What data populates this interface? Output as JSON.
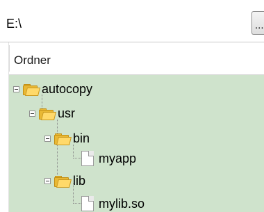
{
  "path": {
    "value": "E:\\",
    "browse_label": "..."
  },
  "tree": {
    "column_header": "Ordner",
    "nodes": [
      {
        "label": "autocopy",
        "type": "folder",
        "icon": "folder-icon",
        "expanded": true,
        "depth": 0
      },
      {
        "label": "usr",
        "type": "folder",
        "icon": "folder-icon",
        "expanded": true,
        "depth": 1
      },
      {
        "label": "bin",
        "type": "folder",
        "icon": "folder-icon",
        "expanded": true,
        "depth": 2
      },
      {
        "label": "myapp",
        "type": "file",
        "icon": "file-icon",
        "depth": 3
      },
      {
        "label": "lib",
        "type": "folder",
        "icon": "folder-icon",
        "expanded": true,
        "depth": 2
      },
      {
        "label": "mylib.so",
        "type": "file",
        "icon": "file-icon",
        "depth": 3
      }
    ]
  },
  "colors": {
    "selection_background": "#cfe3cc",
    "folder": "#e9b834"
  }
}
